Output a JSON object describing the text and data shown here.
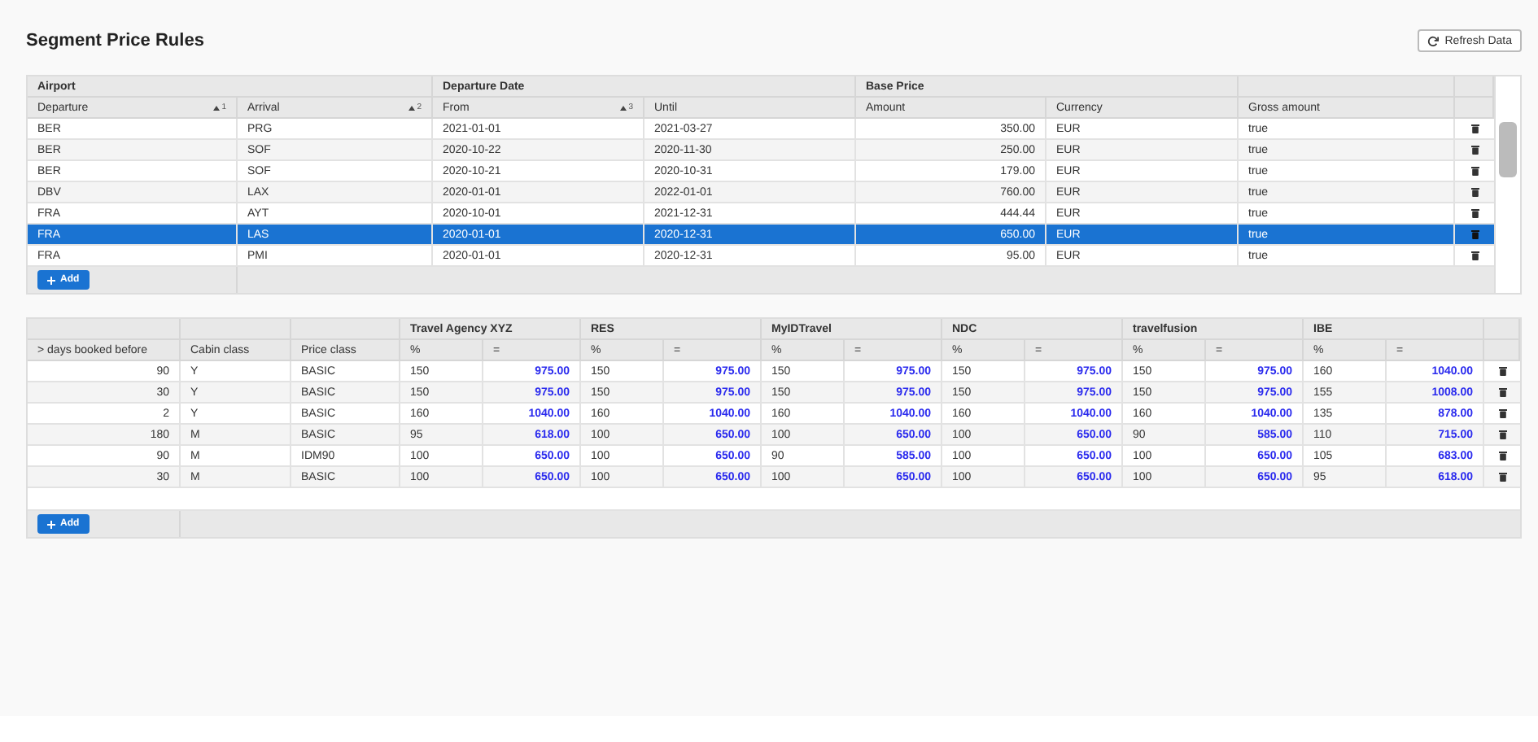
{
  "title": "Segment Price Rules",
  "refresh_button": "Refresh Data",
  "rules_table": {
    "groups": [
      {
        "label": "Airport",
        "columns": [
          {
            "label": "Departure",
            "sort": "1"
          },
          {
            "label": "Arrival",
            "sort": "2"
          }
        ]
      },
      {
        "label": "Departure Date",
        "columns": [
          {
            "label": "From",
            "sort": "3"
          },
          {
            "label": "Until"
          }
        ]
      },
      {
        "label": "Base Price",
        "columns": [
          {
            "label": "Amount"
          },
          {
            "label": "Currency"
          }
        ]
      },
      {
        "columns": [
          {
            "label": "Gross amount"
          }
        ]
      }
    ],
    "rows": [
      {
        "cells": [
          "BER",
          "PRG",
          "2021-01-01",
          "2021-03-27",
          "350.00",
          "EUR",
          "true"
        ],
        "selected": false
      },
      {
        "cells": [
          "BER",
          "SOF",
          "2020-10-22",
          "2020-11-30",
          "250.00",
          "EUR",
          "true"
        ],
        "selected": false
      },
      {
        "cells": [
          "BER",
          "SOF",
          "2020-10-21",
          "2020-10-31",
          "179.00",
          "EUR",
          "true"
        ],
        "selected": false
      },
      {
        "cells": [
          "DBV",
          "LAX",
          "2020-01-01",
          "2022-01-01",
          "760.00",
          "EUR",
          "true"
        ],
        "selected": false
      },
      {
        "cells": [
          "FRA",
          "AYT",
          "2020-10-01",
          "2021-12-31",
          "444.44",
          "EUR",
          "true"
        ],
        "selected": false
      },
      {
        "cells": [
          "FRA",
          "LAS",
          "2020-01-01",
          "2020-12-31",
          "650.00",
          "EUR",
          "true"
        ],
        "selected": true
      },
      {
        "cells": [
          "FRA",
          "PMI",
          "2020-01-01",
          "2020-12-31",
          "95.00",
          "EUR",
          "true"
        ],
        "selected": false
      }
    ],
    "add_button": "Add"
  },
  "price_table": {
    "columns": [
      "> days booked before",
      "Cabin class",
      "Price class"
    ],
    "channels": [
      {
        "name": "Travel Agency XYZ",
        "percent_label": "%",
        "price_label": "="
      },
      {
        "name": "RES",
        "percent_label": "%",
        "price_label": "="
      },
      {
        "name": "MyIDTravel",
        "percent_label": "%",
        "price_label": "="
      },
      {
        "name": "NDC",
        "percent_label": "%",
        "price_label": "="
      },
      {
        "name": "travelfusion",
        "percent_label": "%",
        "price_label": "="
      },
      {
        "name": "IBE",
        "percent_label": "%",
        "price_label": "="
      }
    ],
    "rows": [
      {
        "days": "90",
        "cabin": "Y",
        "price_class": "BASIC",
        "values": [
          [
            "150",
            "975.00"
          ],
          [
            "150",
            "975.00"
          ],
          [
            "150",
            "975.00"
          ],
          [
            "150",
            "975.00"
          ],
          [
            "150",
            "975.00"
          ],
          [
            "160",
            "1040.00"
          ]
        ]
      },
      {
        "days": "30",
        "cabin": "Y",
        "price_class": "BASIC",
        "values": [
          [
            "150",
            "975.00"
          ],
          [
            "150",
            "975.00"
          ],
          [
            "150",
            "975.00"
          ],
          [
            "150",
            "975.00"
          ],
          [
            "150",
            "975.00"
          ],
          [
            "155",
            "1008.00"
          ]
        ]
      },
      {
        "days": "2",
        "cabin": "Y",
        "price_class": "BASIC",
        "values": [
          [
            "160",
            "1040.00"
          ],
          [
            "160",
            "1040.00"
          ],
          [
            "160",
            "1040.00"
          ],
          [
            "160",
            "1040.00"
          ],
          [
            "160",
            "1040.00"
          ],
          [
            "135",
            "878.00"
          ]
        ]
      },
      {
        "days": "180",
        "cabin": "M",
        "price_class": "BASIC",
        "values": [
          [
            "95",
            "618.00"
          ],
          [
            "100",
            "650.00"
          ],
          [
            "100",
            "650.00"
          ],
          [
            "100",
            "650.00"
          ],
          [
            "90",
            "585.00"
          ],
          [
            "110",
            "715.00"
          ]
        ]
      },
      {
        "days": "90",
        "cabin": "M",
        "price_class": "IDM90",
        "values": [
          [
            "100",
            "650.00"
          ],
          [
            "100",
            "650.00"
          ],
          [
            "90",
            "585.00"
          ],
          [
            "100",
            "650.00"
          ],
          [
            "100",
            "650.00"
          ],
          [
            "105",
            "683.00"
          ]
        ]
      },
      {
        "days": "30",
        "cabin": "M",
        "price_class": "BASIC",
        "values": [
          [
            "100",
            "650.00"
          ],
          [
            "100",
            "650.00"
          ],
          [
            "100",
            "650.00"
          ],
          [
            "100",
            "650.00"
          ],
          [
            "100",
            "650.00"
          ],
          [
            "95",
            "618.00"
          ]
        ]
      }
    ],
    "add_button": "Add"
  }
}
